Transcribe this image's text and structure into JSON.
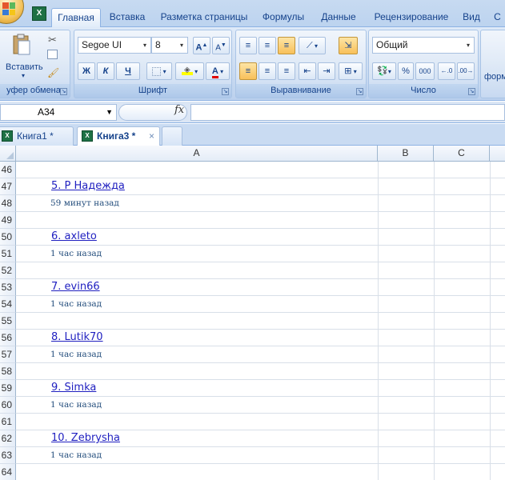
{
  "ribbon": {
    "tabs": [
      "Главная",
      "Вставка",
      "Разметка страницы",
      "Формулы",
      "Данные",
      "Рецензирование",
      "Вид",
      "С"
    ],
    "clipboard": {
      "paste_label": "Вставить",
      "group_label": "уфер обмена"
    },
    "font": {
      "name": "Segoe UI",
      "size": "8",
      "bold": "Ж",
      "italic": "К",
      "underline": "Ч",
      "grow": "A",
      "shrink": "A",
      "color_letter": "A",
      "group_label": "Шрифт"
    },
    "alignment": {
      "group_label": "Выравнивание"
    },
    "number": {
      "format": "Общий",
      "percent": "%",
      "thousands": "000",
      "group_label": "Число"
    },
    "styles": {
      "partial_label": "форм"
    }
  },
  "formula_bar": {
    "cell_ref": "A34",
    "fx_label": "fx",
    "formula": ""
  },
  "workbooks": [
    {
      "label": "Книга1 *",
      "active": false
    },
    {
      "label": "Книга3 *",
      "active": true
    }
  ],
  "grid": {
    "columns": [
      "A",
      "B",
      "C"
    ],
    "rows": [
      {
        "num": "46",
        "a": "",
        "kind": ""
      },
      {
        "num": "47",
        "a": "5. Р Надежда",
        "kind": "link"
      },
      {
        "num": "48",
        "a": "59 минут назад",
        "kind": "ago"
      },
      {
        "num": "49",
        "a": "",
        "kind": ""
      },
      {
        "num": "50",
        "a": "6. axleto",
        "kind": "link"
      },
      {
        "num": "51",
        "a": "1 час назад",
        "kind": "ago"
      },
      {
        "num": "52",
        "a": "",
        "kind": ""
      },
      {
        "num": "53",
        "a": "7. evin66",
        "kind": "link"
      },
      {
        "num": "54",
        "a": "1 час назад",
        "kind": "ago"
      },
      {
        "num": "55",
        "a": "",
        "kind": ""
      },
      {
        "num": "56",
        "a": "8. Lutik70",
        "kind": "link"
      },
      {
        "num": "57",
        "a": "1 час назад",
        "kind": "ago"
      },
      {
        "num": "58",
        "a": "",
        "kind": ""
      },
      {
        "num": "59",
        "a": "9. Simka",
        "kind": "link"
      },
      {
        "num": "60",
        "a": "1 час назад",
        "kind": "ago"
      },
      {
        "num": "61",
        "a": "",
        "kind": ""
      },
      {
        "num": "62",
        "a": "10. Zebrysha",
        "kind": "link"
      },
      {
        "num": "63",
        "a": "1 час назад",
        "kind": "ago"
      },
      {
        "num": "64",
        "a": "",
        "kind": ""
      }
    ]
  },
  "colors": {
    "accent": "#15428b",
    "link": "#1f1fc0",
    "excel_green": "#1e7145",
    "highlight": "#f8c05a"
  }
}
